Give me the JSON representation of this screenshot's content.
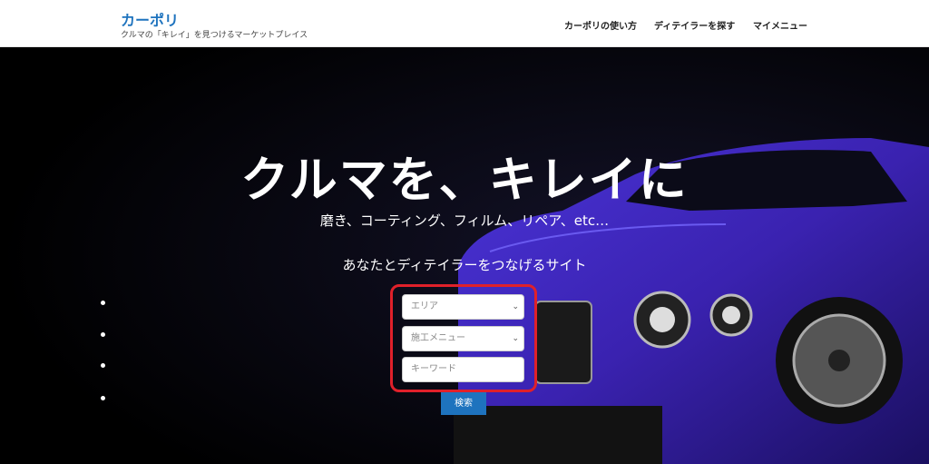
{
  "header": {
    "site_title": "カーポリ",
    "tagline": "クルマの「キレイ」を見つけるマーケットプレイス",
    "nav": [
      {
        "label": "カーポリの使い方"
      },
      {
        "label": "ディテイラーを探す"
      },
      {
        "label": "マイメニュー"
      }
    ]
  },
  "hero": {
    "title": "クルマを、キレイに",
    "subtitle": "磨き、コーティング、フィルム、リペア、etc…",
    "subtitle2": "あなたとディテイラーをつなげるサイト",
    "car_color": "#3a22b0"
  },
  "search": {
    "area_placeholder": "エリア",
    "menu_placeholder": "施工メニュー",
    "keyword_placeholder": "キーワード",
    "button_label": "検索"
  },
  "colors": {
    "accent": "#1e73be",
    "highlight": "#e0202a"
  }
}
